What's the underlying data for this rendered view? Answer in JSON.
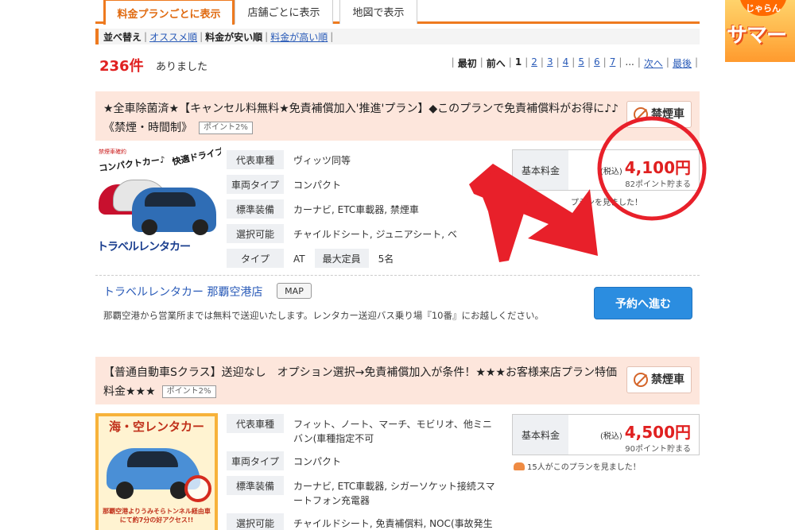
{
  "tabs": [
    {
      "label": "料金プランごとに表示",
      "active": true
    },
    {
      "label": "店舗ごとに表示",
      "active": false
    },
    {
      "label": "地図で表示",
      "active": false
    }
  ],
  "side_banner": {
    "line1": "じゃらん",
    "line2": "サマー"
  },
  "sort": {
    "label": "並べ替え",
    "recommended": "オススメ順",
    "cheap": "料金が安い順",
    "expensive": "料金が高い順"
  },
  "results": {
    "count": "236件",
    "text": "ありました"
  },
  "pager": {
    "first": "最初",
    "prev": "前へ",
    "current": "1",
    "pages": [
      "2",
      "3",
      "4",
      "5",
      "6",
      "7"
    ],
    "ellipsis": "...",
    "next": "次へ",
    "last": "最後"
  },
  "plans": [
    {
      "title": "★全車除菌済★【キャンセル料無料★免責補償加入'推進'プラン】◆このプランで免責補償料がお得に♪♪《禁煙・時間制》",
      "point_badge": "ポイント2%",
      "smoke": "禁煙車",
      "image": {
        "tag": "禁煙車確約",
        "headline": "コンパクトカー♪",
        "headline2": "快適ドライブ♪",
        "logo": "トラベルレンタカー"
      },
      "specs": [
        {
          "k": "代表車種",
          "v": "ヴィッツ同等"
        },
        {
          "k": "車両タイプ",
          "v": "コンパクト"
        },
        {
          "k": "標準装備",
          "v": "カーナビ, ETC車載器, 禁煙車"
        },
        {
          "k": "選択可能",
          "v": "チャイルドシート, ジュニアシート, ベ"
        },
        {
          "k": "タイプ",
          "v": "AT",
          "k2": "最大定員",
          "v2": "5名"
        }
      ],
      "price": {
        "label": "基本料金",
        "tax": "(税込)",
        "amount": "4,100円",
        "points": "82ポイント貯まる"
      },
      "viewed": "プランを見ました！",
      "store": "トラベルレンタカー 那覇空港店",
      "map": "MAP",
      "access": "那覇空港から営業所までは無料で送迎いたします。レンタカー送迎バス乗り場『10番』にお越しください。",
      "reserve": "予約へ進む"
    },
    {
      "title": "【普通自動車Sクラス】送迎なし　オプション選択→免責補償加入が条件！★★★お客様来店プラン特価料金★★★",
      "point_badge": "ポイント2%",
      "smoke": "禁煙車",
      "image": {
        "title": "海・空レンタカー",
        "caption": "那覇空港よりうみそらトンネル経由車にて約7分の好アクセス!!"
      },
      "specs": [
        {
          "k": "代表車種",
          "v": "フィット、ノート、マーチ、モビリオ、他ミニバン(車種指定不可"
        },
        {
          "k": "車両タイプ",
          "v": "コンパクト"
        },
        {
          "k": "標準装備",
          "v": "カーナビ, ETC車載器, シガーソケット接続スマートフォン充電器"
        },
        {
          "k": "選択可能",
          "v": "チャイルドシート, 免責補償料, NOC(事故発生時"
        }
      ],
      "price": {
        "label": "基本料金",
        "tax": "(税込)",
        "amount": "4,500円",
        "points": "90ポイント貯まる"
      },
      "viewed": "15人がこのプランを見ました！"
    }
  ],
  "colors": {
    "accent": "#ee7a1f",
    "price": "#e02020",
    "link": "#2a5bb8",
    "plan_bg": "#fde6dc",
    "reserve": "#2b8de0",
    "annotation": "#e8202a"
  }
}
